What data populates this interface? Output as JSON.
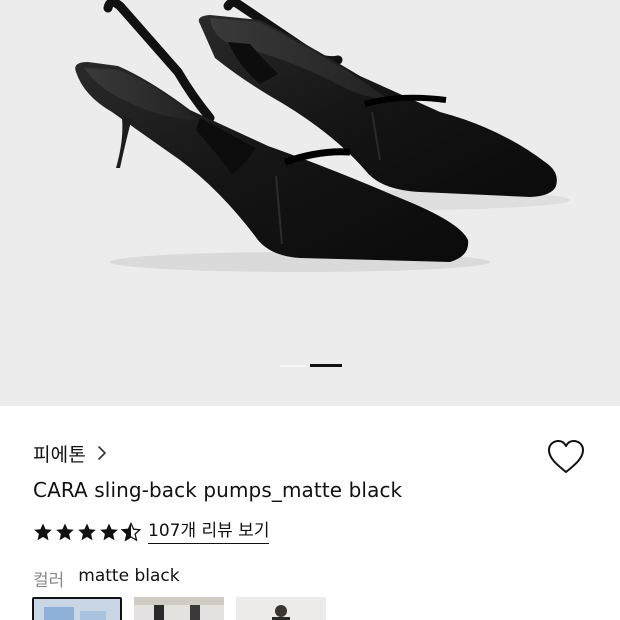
{
  "product": {
    "brand": "피에톤",
    "title": "CARA sling-back pumps_matte black",
    "rating": 4.5,
    "reviews_label": "107개 리뷰 보기"
  },
  "gallery": {
    "image": "black-slingback-pumps-product-photo",
    "total_pages": 2,
    "current_page": 2
  },
  "options": {
    "color_label": "컬러",
    "color_value": "matte black",
    "swatches": [
      {
        "name": "swatch-1",
        "selected": true
      },
      {
        "name": "swatch-2",
        "selected": false
      },
      {
        "name": "swatch-3",
        "selected": false
      }
    ]
  },
  "icons": {
    "brand_arrow": "chevron-right-icon",
    "wishlist": "heart-icon",
    "rating": "star-icon"
  },
  "colors": {
    "text": "#111111",
    "muted": "#8a8a8a",
    "hero_bg": "#ececec",
    "shoe": "#151515"
  }
}
